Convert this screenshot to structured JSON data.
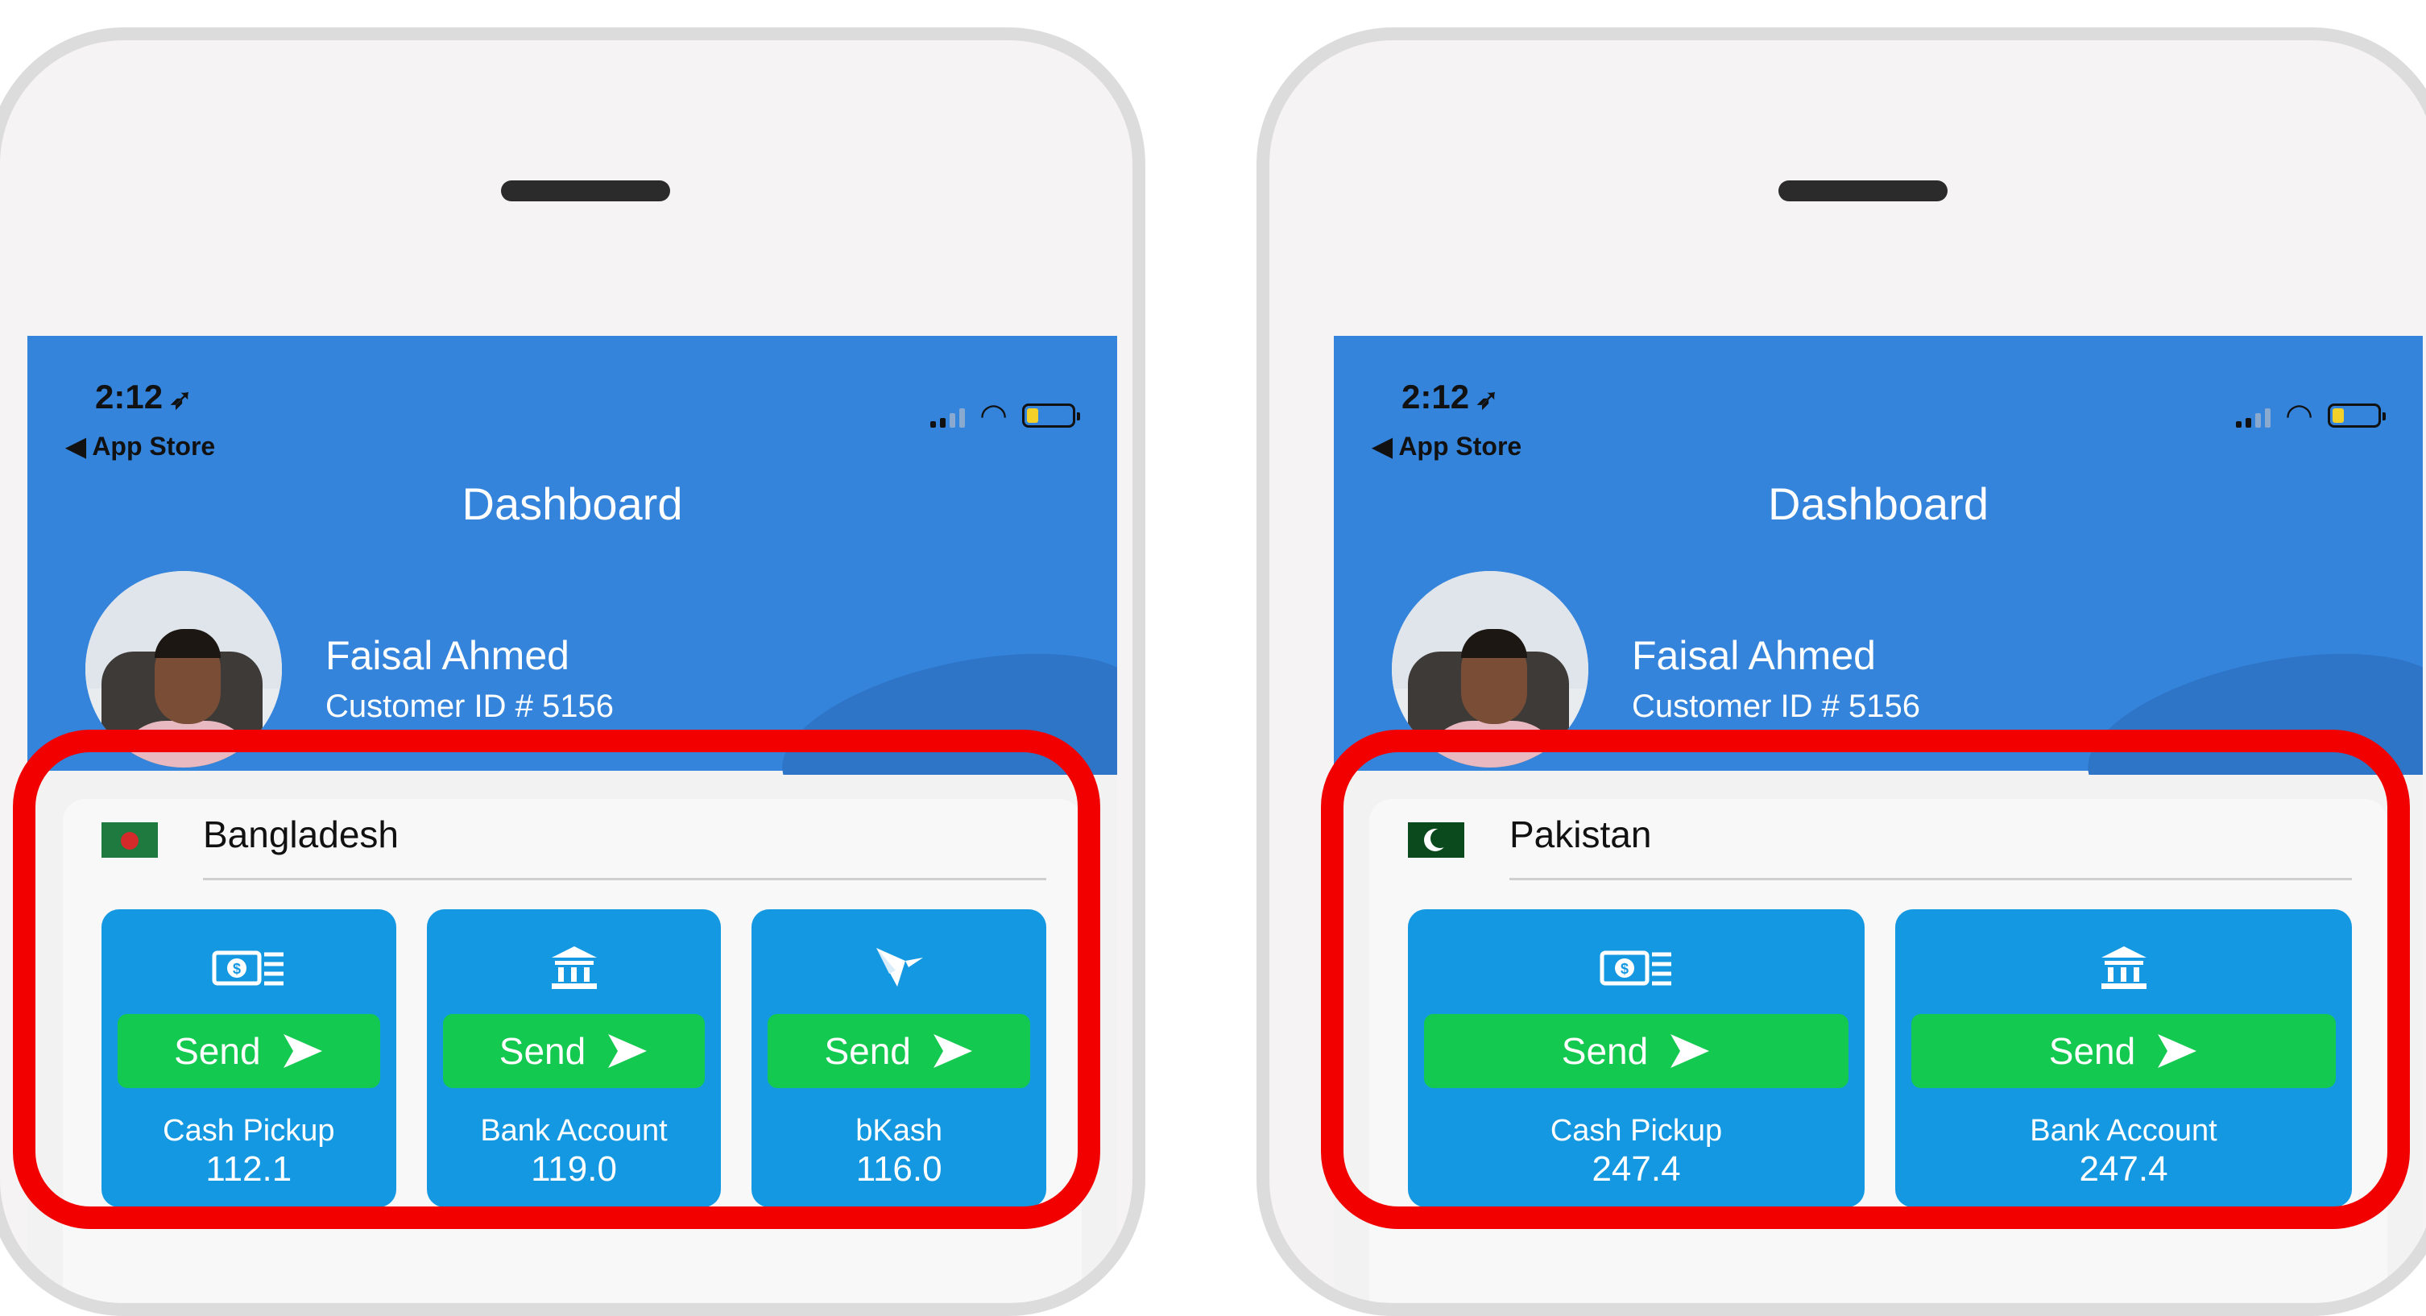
{
  "colors": {
    "header_blue": "#3584dc",
    "tile_blue": "#1598e2",
    "send_green": "#13c94f",
    "highlight_red": "#f20000"
  },
  "screens": [
    {
      "status": {
        "time": "2:12",
        "back_label": "◀ App Store"
      },
      "title": "Dashboard",
      "user": {
        "name": "Faisal Ahmed",
        "customer_id": "Customer ID # 5156"
      },
      "country": {
        "name": "Bangladesh",
        "flag": "bangladesh-flag-icon"
      },
      "options": [
        {
          "icon": "money-icon",
          "send_label": "Send",
          "label": "Cash Pickup",
          "rate": "112.1"
        },
        {
          "icon": "bank-icon",
          "send_label": "Send",
          "label": "Bank Account",
          "rate": "119.0"
        },
        {
          "icon": "bkash-bird-icon",
          "send_label": "Send",
          "label": "bKash",
          "rate": "116.0"
        }
      ]
    },
    {
      "status": {
        "time": "2:12",
        "back_label": "◀ App Store"
      },
      "title": "Dashboard",
      "user": {
        "name": "Faisal Ahmed",
        "customer_id": "Customer ID # 5156"
      },
      "country": {
        "name": "Pakistan",
        "flag": "pakistan-flag-icon"
      },
      "options": [
        {
          "icon": "money-icon",
          "send_label": "Send",
          "label": "Cash Pickup",
          "rate": "247.4"
        },
        {
          "icon": "bank-icon",
          "send_label": "Send",
          "label": "Bank Account",
          "rate": "247.4"
        }
      ]
    }
  ]
}
